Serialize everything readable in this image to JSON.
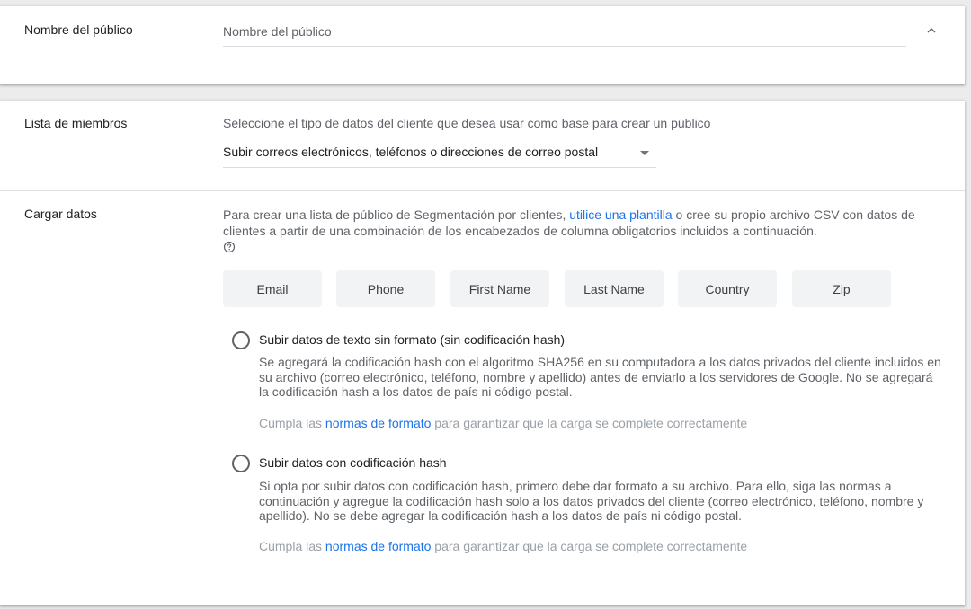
{
  "audience_name": {
    "label": "Nombre del público",
    "placeholder": "Nombre del público",
    "value": ""
  },
  "member_list": {
    "label": "Lista de miembros",
    "description": "Seleccione el tipo de datos del cliente que desea usar como base para crear un público",
    "selected": "Subir correos electrónicos, teléfonos o direcciones de correo postal"
  },
  "upload_data": {
    "label": "Cargar datos",
    "description_before_link": "Para crear una lista de público de Segmentación por clientes, ",
    "link_text": "utilice una plantilla",
    "description_after_link": " o cree su propio archivo CSV con datos de clientes a partir de una combinación de los encabezados de columna obligatorios incluidos a continuación.",
    "columns": [
      "Email",
      "Phone",
      "First Name",
      "Last Name",
      "Country",
      "Zip"
    ],
    "options": [
      {
        "title": "Subir datos de texto sin formato (sin codificación hash)",
        "description": "Se agregará la codificación hash con el algoritmo SHA256 en su computadora a los datos privados del cliente incluidos en su archivo (correo electrónico, teléfono, nombre y apellido) antes de enviarlo a los servidores de Google. No se agregará la codificación hash a los datos de país ni código postal.",
        "note_before": "Cumpla las ",
        "note_link": "normas de formato",
        "note_after": " para garantizar que la carga se complete correctamente",
        "selected": false
      },
      {
        "title": "Subir datos con codificación hash",
        "description": "Si opta por subir datos con codificación hash, primero debe dar formato a su archivo. Para ello, siga las normas a continuación y agregue la codificación hash solo a los datos privados del cliente (correo electrónico, teléfono, nombre y apellido). No se debe agregar la codificación hash a los datos de país ni código postal.",
        "note_before": "Cumpla las ",
        "note_link": "normas de formato",
        "note_after": " para garantizar que la carga se complete correctamente",
        "selected": false
      }
    ]
  },
  "icons": {
    "collapse": "chevron-up-icon",
    "dropdown": "dropdown-arrow-icon",
    "help": "help-circle-icon"
  },
  "colors": {
    "link": "#1a73e8",
    "chip_background": "#f1f3f4",
    "page_background": "#ececec"
  }
}
